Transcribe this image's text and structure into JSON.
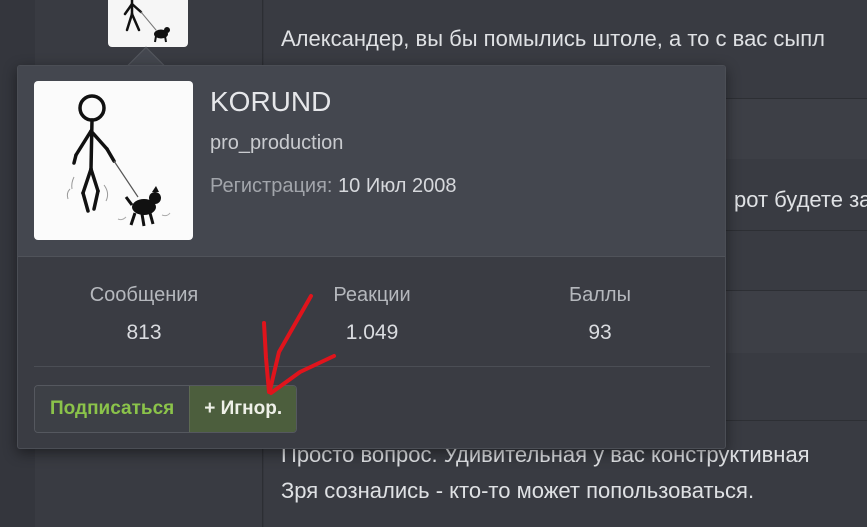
{
  "posts": {
    "line_1": "Александер, вы бы помылись штоле, а то с вас сыпл",
    "line_2": "рот будете за",
    "line_3": "Просто вопрос. Удивительная у вас конструктивная",
    "line_4": "Зря сознались - кто-то может попользоваться."
  },
  "profile": {
    "username": "KORUND",
    "user_title": "pro_production",
    "registration_label": "Регистрация:",
    "registration_date": "10 Июл 2008",
    "avatar_icon": "stick-figure-walking-dog-icon"
  },
  "stats": [
    {
      "label": "Сообщения",
      "value": "813"
    },
    {
      "label": "Реакции",
      "value": "1.049"
    },
    {
      "label": "Баллы",
      "value": "93"
    }
  ],
  "actions": {
    "follow_label": "Подписаться",
    "ignore_label": "+ Игнор."
  },
  "colors": {
    "follow_text": "#8bc34a",
    "ignore_bg": "#4c5e3d",
    "annotation_arrow": "#e0141c"
  },
  "annotation_icon": "red-arrow-icon"
}
